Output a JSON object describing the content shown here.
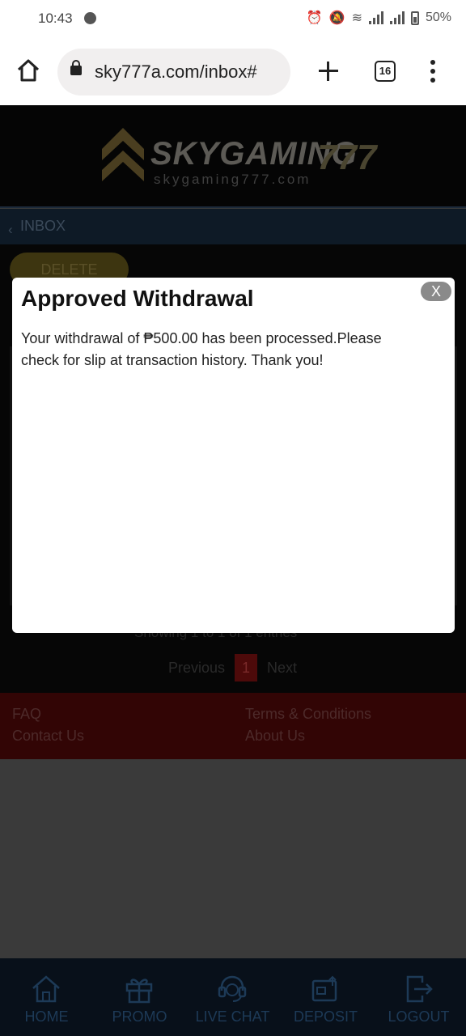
{
  "status_bar": {
    "time": "10:43",
    "battery": "50%",
    "icons": [
      "messenger-icon",
      "alarm-icon",
      "mute-icon",
      "wifi-icon",
      "signal-icon",
      "signal-icon",
      "battery-icon"
    ]
  },
  "browser": {
    "url": "sky777a.com/inbox#",
    "tab_count": "16",
    "icons": [
      "home-icon",
      "lock-icon",
      "plus-icon",
      "tabs-icon",
      "menu-icon"
    ]
  },
  "site": {
    "logo_text": "SKYGAMING",
    "logo_number": "777",
    "logo_subtext": "skygaming777.com",
    "inbox_label": "INBOX",
    "delete_label": "DELETE",
    "showing_text": "Showing 1 to 1 of 1 entries",
    "pagination": {
      "previous": "Previous",
      "current": "1",
      "next": "Next"
    },
    "footer": {
      "faq": "FAQ",
      "contact": "Contact Us",
      "terms": "Terms & Conditions",
      "about": "About Us"
    },
    "colors": {
      "header_bg": "#050505",
      "footer_bg": "#320505",
      "nav_bg": "#08101a",
      "accent_gold": "#3d3510"
    }
  },
  "bottom_nav": [
    {
      "label": "HOME",
      "icon": "home-icon"
    },
    {
      "label": "PROMO",
      "icon": "gift-icon"
    },
    {
      "label": "LIVE CHAT",
      "icon": "headset-icon"
    },
    {
      "label": "DEPOSIT",
      "icon": "wallet-icon"
    },
    {
      "label": "LOGOUT",
      "icon": "logout-icon"
    }
  ],
  "modal": {
    "title": "Approved Withdrawal",
    "close_label": "X",
    "body_line1": "Your withdrawal of ₱500.00 has been processed.Please",
    "body_line2": "check for slip at transaction history. Thank you!"
  }
}
